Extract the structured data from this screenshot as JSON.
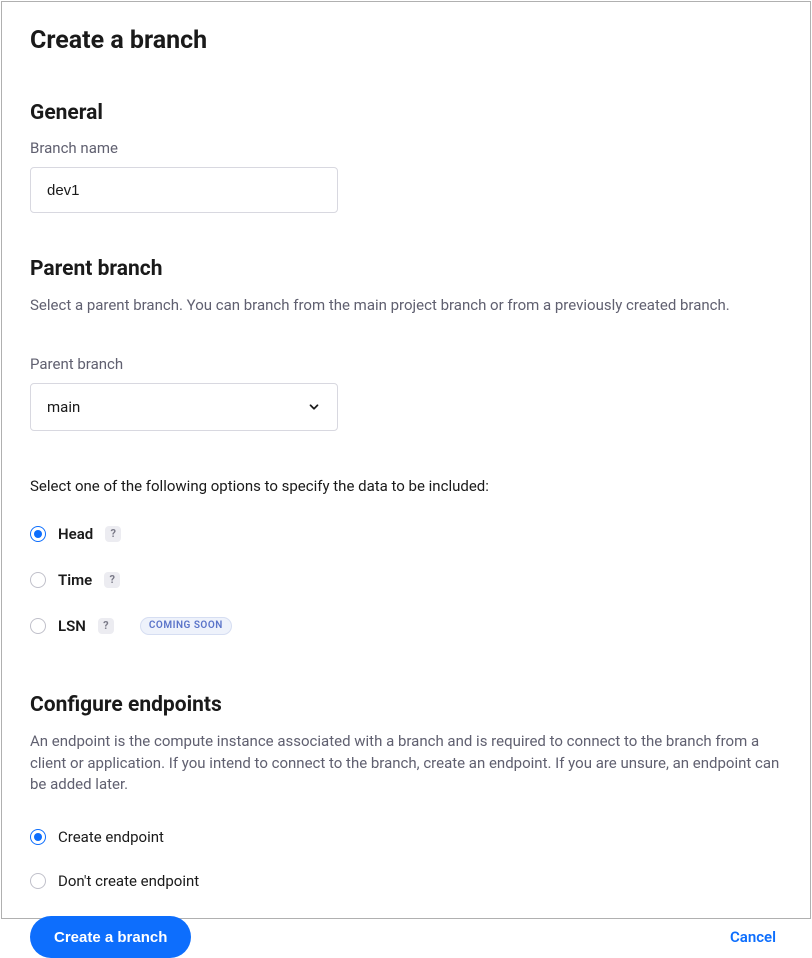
{
  "title": "Create a branch",
  "general": {
    "heading": "General",
    "branch_name_label": "Branch name",
    "branch_name_value": "dev1"
  },
  "parent": {
    "heading": "Parent branch",
    "description": "Select a parent branch. You can branch from the main project branch or from a previously created branch.",
    "select_label": "Parent branch",
    "selected": "main",
    "data_hint": "Select one of the following options to specify the data to be included:",
    "options": [
      {
        "label": "Head",
        "checked": true,
        "help": true,
        "coming_soon": false
      },
      {
        "label": "Time",
        "checked": false,
        "help": true,
        "coming_soon": false
      },
      {
        "label": "LSN",
        "checked": false,
        "help": true,
        "coming_soon": true
      }
    ],
    "coming_soon_text": "COMING SOON",
    "help_glyph": "?"
  },
  "endpoints": {
    "heading": "Configure endpoints",
    "description": "An endpoint is the compute instance associated with a branch and is required to connect to the branch from a client or application. If you intend to connect to the branch, create an endpoint. If you are unsure, an endpoint can be added later.",
    "options": [
      {
        "label": "Create endpoint",
        "checked": true
      },
      {
        "label": "Don't create endpoint",
        "checked": false
      }
    ]
  },
  "footer": {
    "submit_label": "Create a branch",
    "cancel_label": "Cancel"
  }
}
